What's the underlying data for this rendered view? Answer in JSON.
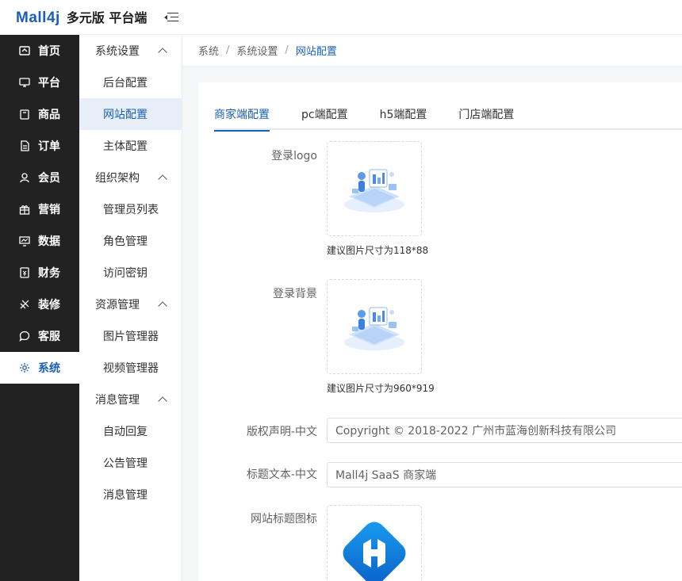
{
  "header": {
    "logo_mark": "Mall4j",
    "logo_title": "多元版 平台端"
  },
  "sidebar": {
    "items": [
      {
        "label": "首页",
        "icon": "home-icon"
      },
      {
        "label": "平台",
        "icon": "monitor-icon"
      },
      {
        "label": "商品",
        "icon": "bag-icon"
      },
      {
        "label": "订单",
        "icon": "document-icon"
      },
      {
        "label": "会员",
        "icon": "members-icon"
      },
      {
        "label": "营销",
        "icon": "gift-icon"
      },
      {
        "label": "数据",
        "icon": "chart-icon"
      },
      {
        "label": "财务",
        "icon": "finance-icon"
      },
      {
        "label": "装修",
        "icon": "decorate-icon"
      },
      {
        "label": "客服",
        "icon": "chat-icon"
      },
      {
        "label": "系统",
        "icon": "gear-icon",
        "active": true
      }
    ]
  },
  "submenu": {
    "groups": [
      {
        "title": "系统设置",
        "items": [
          "后台配置",
          "网站配置",
          "主体配置"
        ]
      },
      {
        "title": "组织架构",
        "items": [
          "管理员列表",
          "角色管理",
          "访问密钥"
        ]
      },
      {
        "title": "资源管理",
        "items": [
          "图片管理器",
          "视频管理器"
        ]
      },
      {
        "title": "消息管理",
        "items": [
          "自动回复",
          "公告管理",
          "消息管理"
        ]
      }
    ]
  },
  "breadcrumb": {
    "items": [
      "系统",
      "系统设置",
      "网站配置"
    ],
    "separator": "/"
  },
  "tabs": [
    "商家端配置",
    "pc端配置",
    "h5端配置",
    "门店端配置"
  ],
  "form": {
    "login_logo_label": "登录logo",
    "login_logo_hint": "建议图片尺寸为118*88",
    "login_bg_label": "登录背景",
    "login_bg_hint": "建议图片尺寸为960*919",
    "copyright_label": "版权声明-中文",
    "copyright_value": "Copyright © 2018-2022 广州市蓝海创新科技有限公司",
    "title_text_label": "标题文本-中文",
    "title_text_value": "Mall4j SaaS 商家端",
    "favicon_label": "网站标题图标"
  },
  "colors": {
    "accent": "#1b5fb5",
    "sidebar_bg": "#222222",
    "active_sub_bg": "#e8eef8"
  }
}
